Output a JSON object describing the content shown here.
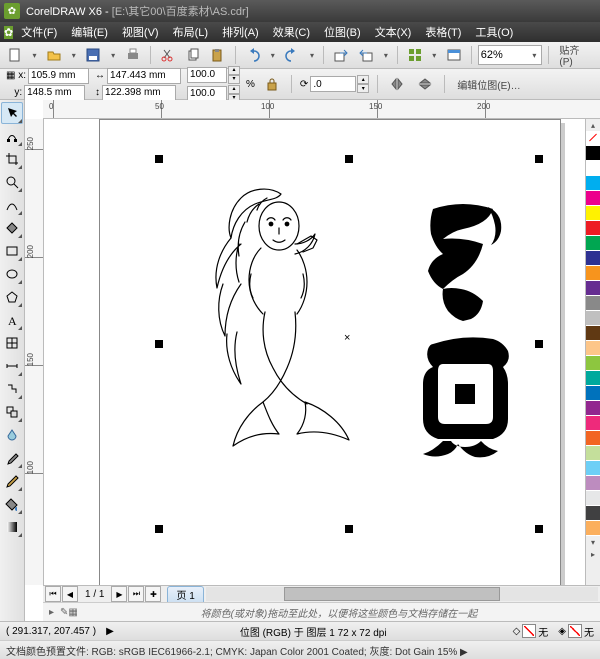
{
  "title": {
    "app": "CorelDRAW X6",
    "sep": " - ",
    "doc": "[E:\\其它00\\百度素材\\AS.cdr]"
  },
  "menu": {
    "file": "文件(F)",
    "edit": "编辑(E)",
    "view": "视图(V)",
    "layout": "布局(L)",
    "arrange": "排列(A)",
    "effects": "效果(C)",
    "bitmaps": "位图(B)",
    "text": "文本(X)",
    "table": "表格(T)",
    "tools": "工具(O)"
  },
  "std": {
    "zoom": "62%",
    "snap": "贴齐(P)"
  },
  "prop": {
    "x": "105.9 mm",
    "y": "148.5 mm",
    "w": "147.443 mm",
    "h": "122.398 mm",
    "sx": "100.0",
    "sy": "100.0",
    "pct": "%",
    "rot": ".0",
    "editbmp": "编辑位图(E)…"
  },
  "ruler": {
    "h": [
      "0",
      "50",
      "100",
      "150",
      "200"
    ],
    "v": [
      "250",
      "200",
      "150",
      "100"
    ]
  },
  "pagenav": {
    "info": "1 / 1",
    "tab": "页 1"
  },
  "hint": {
    "text": "将颜色(或对象)拖动至此处，以便将这些颜色与文档存储在一起"
  },
  "status": {
    "cursor": "( 291.317, 207.457 )",
    "obj": "位图 (RGB) 于 图层 1 72 x 72 dpi",
    "fill": "无",
    "outline": "无"
  },
  "profile": {
    "text": "文档颜色预置文件: RGB: sRGB IEC61966-2.1; CMYK: Japan Color 2001 Coated; 灰度: Dot Gain 15% ▶"
  },
  "palette": [
    "#000000",
    "#ffffff",
    "#00aeef",
    "#ec008c",
    "#fff200",
    "#ed1c24",
    "#00a651",
    "#2e3192",
    "#f7941d",
    "#662d91",
    "#898989",
    "#c0c0c0",
    "#603913",
    "#fdc689",
    "#8dc63f",
    "#00a99d",
    "#0072bc",
    "#92278f",
    "#ee2a7b",
    "#f26522",
    "#c4df9b",
    "#6dcff6",
    "#bd8cbf",
    "#e6e7e8",
    "#404041",
    "#fbaf5d"
  ]
}
